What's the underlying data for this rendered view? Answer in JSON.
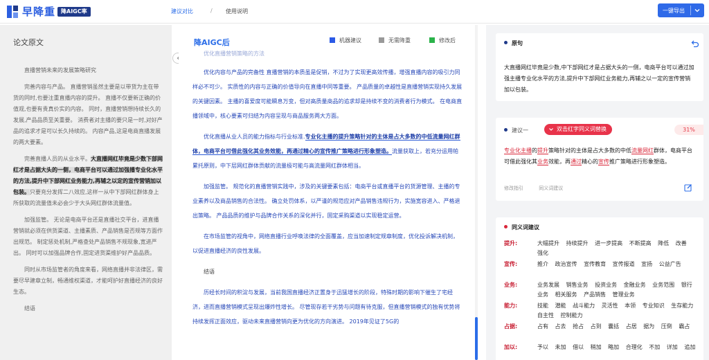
{
  "header": {
    "logo_text": "早降重",
    "logo_badge": "降AIGC率",
    "nav_active": "建议对比",
    "nav_separator": "/",
    "nav_help": "使用说明",
    "export_label": "一键导出"
  },
  "left": {
    "title": "论文原文",
    "heading": "直播营销未来的发展策略研究",
    "p1": "完善内容与产品。 直播营销虽然主要是以带货为主在带货的同时,也要注重直播内容的提升。 直播不仅要新正确的价值观,也要有贵真价实的内容。 同时，直播营销想持续长久的发展,产品品质至关重要。 消费者对主播的要只是一时,对好产品的追求才是可以长久持续的。 内容产品,这是电商直播发展的两大要素。",
    "p2_pre": "完善直播人员的从业水平。",
    "p2_hl": "大直播网红毕竟是少数下部网红才是占据大头的一侧，电商平台可以通过加强播专业化水平的方法,提升中下部网红业务能力,再辅之以定的宣传营销加以包装。",
    "p2_post": "只要充分发挥二八效应,这样一从中下部网红群体身上所获取的流量值未必会少于大头网红群体流量值。",
    "p3": "加强监管。 无论是电商平台还是直播社交平台，进直播营销就必须在供货渠道、主播素质、产品销售是否规等方面作出规范。 制定惩处机制,严格查处产品销售不规现象,宽进严出。 同时可以加强品牌合作,固定进货渠维护好产品品质。",
    "p4": "同时从市场监管者的角度来看，网络直播并非法律区，需要尽早建章立制，畅通维权渠道，才能呵护好直播经济的良好生态。",
    "p5": "结语"
  },
  "middle": {
    "title": "降AIGC后",
    "legend": [
      {
        "label": "机器建议",
        "color": "#2b5ae6"
      },
      {
        "label": "无需降重",
        "color": "#999999"
      },
      {
        "label": "修改后",
        "color": "#2bb34a"
      }
    ],
    "faded_line": "优化直播营销策略的方法",
    "p1": "优化内容与产品的完备性 直播营销的本质虽是促销，不过为了实现更高效传播，增强直播内容的吸引力同样必不可少。 实质性的内容与正确的价值导向在直播中同等重要。 产品质量的卓越性是直播营销实现持久发展的关键因素。 主播的喜爱度可能瞬息万变，但对高质量商品的追求却是持续不变的消费者行为模式。 在电商直播领域中，核心要素可归结为内容呈现与商品服务两大方面。",
    "p2_pre": "优化直播从业人员的能力指标与行业标准.",
    "p2_sel": "专业化主播的提升策略针对的主体是占大多数的中低流量网红群体，电商平台可借此强化其业务效能，再通过精心的宣传推广策略进行形象塑造。",
    "p2_post": "流量获取上，若充分运用帕累托原则，中下层网红群体贡献的流量极可能与高流量网红群体相当。",
    "p3": "加强监管。 规范化的直播营销实践中，涉及的关键要素包括：电商平台或直播平台的货源管理、主播的专业素养以及商品销售的合法性。 确立处罚体系，以严谨的规范应对产品销售违规行为，实施宽容进入、严格退出策略。 产品品质的维护与品牌合作关系的深化并行，固定采购渠道以实现稳定运营。",
    "p4": "在市场监管的视角中，网络直播行业呼唤法律的全面覆盖，应当加速制定规章制度，优化投诉解决机制，以促进直播经济的良性发展。",
    "p5": "结语",
    "p6": "历经长时间的积淀与发展，当前我国直播经济正置身于迅猛增长的阶段，特殊时期的影响下催生了宅经济，进而直播营销模式呈现出爆炸性增长。 尽管现存若干劣势与问题有待克服，但直播营销模式的独有优势将持续发挥正面效应，驱动未来直播营销向更为优化的方向演进。 2019年见证了5G的"
  },
  "right": {
    "orig_title": "原句",
    "orig_text": "大直播网红毕竟是少数,中下部网红才是占据大头的一侧，电商平台可以通过加强主播专业化水平的方法,提升中下部网红业务能力,再辅之以一定的宣传营销加以包装。",
    "sug_label": "建议一",
    "sug_pill": "双击红字同义词替换",
    "sug_pct": "31%",
    "sug_text": [
      {
        "t": "专业化主播",
        "r": true
      },
      {
        "t": "的",
        "r": false
      },
      {
        "t": "提升",
        "r": true
      },
      {
        "t": "策略针对的主体是占大多数的中低",
        "r": false
      },
      {
        "t": "流量网红",
        "r": true
      },
      {
        "t": "群体，电商平台可借此强化其",
        "r": false
      },
      {
        "t": "业务",
        "r": true
      },
      {
        "t": "效能，再",
        "r": false
      },
      {
        "t": "通过",
        "r": true
      },
      {
        "t": "精心的",
        "r": false
      },
      {
        "t": "宣传",
        "r": true
      },
      {
        "t": "推广策略进行形象塑造。",
        "r": false
      }
    ],
    "action_edit": "修改指引",
    "action_syn": "同义词建议",
    "syn_title": "同义词建议",
    "synonyms": [
      {
        "key": "提升:",
        "vals": "大幅提升 持续提升 进一步提高 不断提高 降低 改善 强化"
      },
      {
        "key": "宣传:",
        "vals": "推介 政治宣传 宣传教育 宣传报道 宣扬 公益广告"
      },
      {
        "key": "业务:",
        "vals": "业务发展 销售业务 投资业务 金融业务 业务范围 银行业务 相关服务 产品销售 管理业务"
      },
      {
        "key": "能力:",
        "vals": "技能 潜能 战斗能力 灵活性 本领 专业知识 生存能力 自主性 控制能力"
      },
      {
        "key": "占据:",
        "vals": "占有 占去 抢占 占到 囊括 占居 据为 压倒 霸占"
      },
      {
        "key": "加以:",
        "vals": "予以 未加 借以 稍加 略加 合理化 不加 详加 追加"
      }
    ]
  },
  "colors": {
    "brand": "#2c5fe0",
    "accent": "#2b6de8",
    "red": "#e8334a"
  }
}
